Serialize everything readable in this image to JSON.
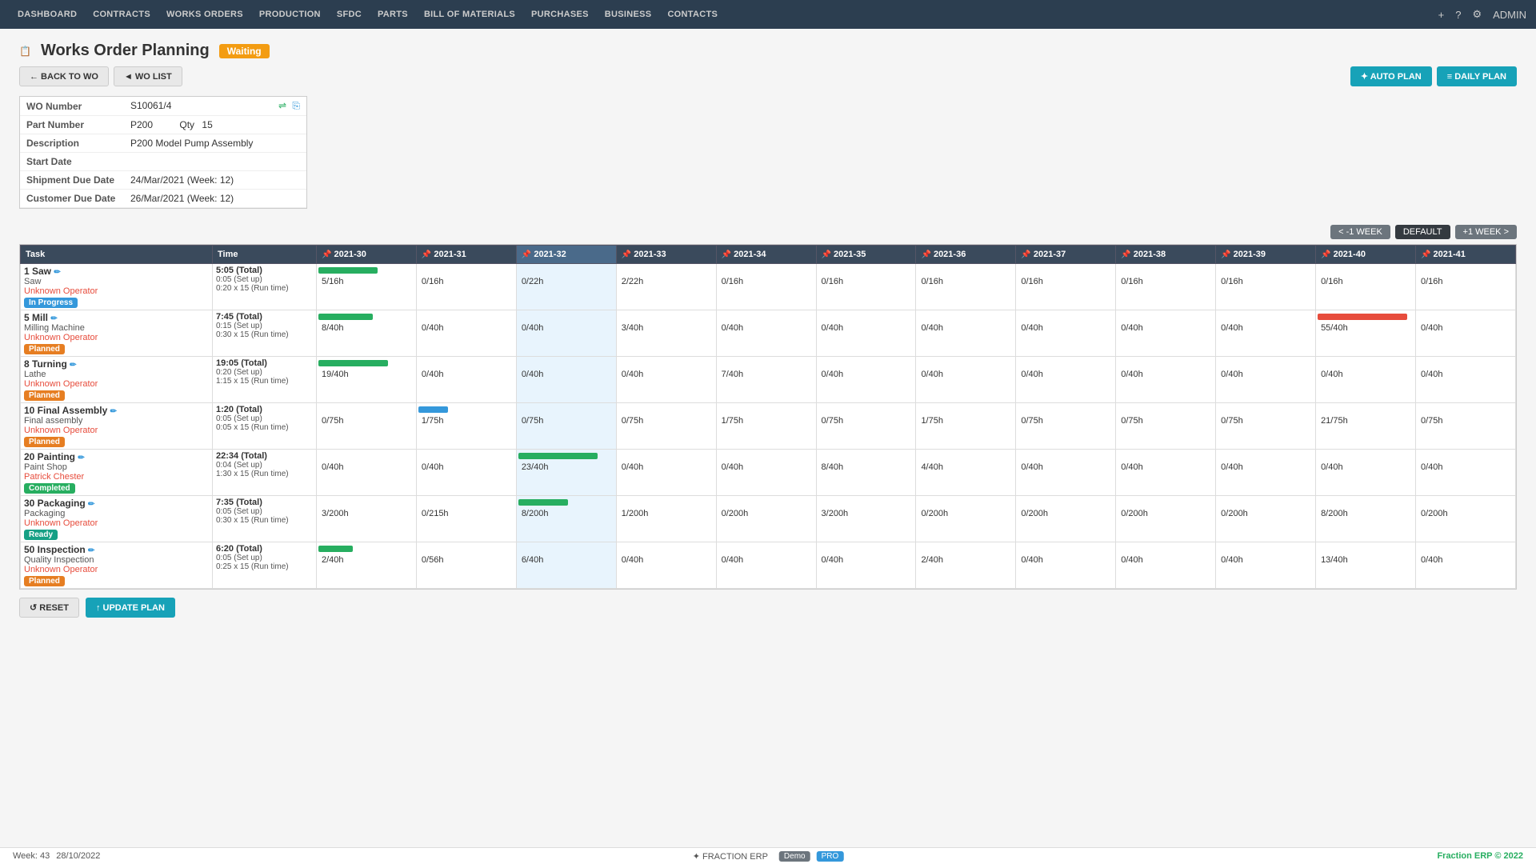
{
  "nav": {
    "items": [
      "DASHBOARD",
      "CONTRACTS",
      "WORKS ORDERS",
      "PRODUCTION",
      "SFDC",
      "PARTS",
      "BILL OF MATERIALS",
      "PURCHASES",
      "BUSINESS",
      "CONTACTS"
    ],
    "admin": "ADMIN"
  },
  "page": {
    "title": "Works Order Planning",
    "status": "Waiting",
    "back_btn": "← BACK TO WO",
    "list_btn": "◄ WO LIST",
    "auto_plan": "✦ AUTO PLAN",
    "daily_plan": "≡ DAILY PLAN"
  },
  "wo": {
    "number_label": "WO Number",
    "number_value": "S10061/4",
    "part_label": "Part Number",
    "part_value": "P200",
    "qty_label": "Qty",
    "qty_value": "15",
    "desc_label": "Description",
    "desc_value": "P200 Model Pump Assembly",
    "start_label": "Start Date",
    "start_value": "",
    "ship_label": "Shipment Due Date",
    "ship_value": "24/Mar/2021 (Week: 12)",
    "cust_label": "Customer Due Date",
    "cust_value": "26/Mar/2021 (Week: 12)"
  },
  "week_nav": {
    "prev": "< -1 WEEK",
    "default": "DEFAULT",
    "next": "+1 WEEK >"
  },
  "columns": {
    "task": "Task",
    "time": "Time",
    "weeks": [
      "2021-30",
      "2021-31",
      "2021-32",
      "2021-33",
      "2021-34",
      "2021-35",
      "2021-36",
      "2021-37",
      "2021-38",
      "2021-39",
      "2021-40",
      "2021-41"
    ]
  },
  "tasks": [
    {
      "id": "1 Saw",
      "sub": "Saw",
      "operator": "Unknown Operator",
      "status": "In Progress",
      "status_key": "inprogress",
      "total": "5:05 (Total)",
      "setup": "0:05 (Set up)",
      "runtime": "0:20 x 15 (Run time)",
      "weeks": [
        "5/16h",
        "0/16h",
        "0/22h",
        "2/22h",
        "0/16h",
        "0/16h",
        "0/16h",
        "0/16h",
        "0/16h",
        "0/16h",
        "0/16h",
        "0/16h"
      ],
      "bar_week": 0,
      "bar_pct": 60,
      "bar_color": "green",
      "highlight_week": 2
    },
    {
      "id": "5 Mill",
      "sub": "Milling Machine",
      "operator": "Unknown Operator",
      "status": "Planned",
      "status_key": "planned",
      "total": "7:45 (Total)",
      "setup": "0:15 (Set up)",
      "runtime": "0:30 x 15 (Run time)",
      "weeks": [
        "8/40h",
        "0/40h",
        "0/40h",
        "3/40h",
        "0/40h",
        "0/40h",
        "0/40h",
        "0/40h",
        "0/40h",
        "0/40h",
        "55/40h",
        "0/40h"
      ],
      "bar_week": 0,
      "bar_pct": 55,
      "bar_color": "green",
      "bar2_week": 10,
      "bar2_pct": 90,
      "bar2_color": "red",
      "highlight_week": 2
    },
    {
      "id": "8 Turning",
      "sub": "Lathe",
      "operator": "Unknown Operator",
      "status": "Planned",
      "status_key": "planned",
      "total": "19:05 (Total)",
      "setup": "0:20 (Set up)",
      "runtime": "1:15 x 15 (Run time)",
      "weeks": [
        "19/40h",
        "0/40h",
        "0/40h",
        "0/40h",
        "7/40h",
        "0/40h",
        "0/40h",
        "0/40h",
        "0/40h",
        "0/40h",
        "0/40h",
        "0/40h"
      ],
      "bar_week": 0,
      "bar_pct": 70,
      "bar_color": "green",
      "highlight_week": 2
    },
    {
      "id": "10 Final Assembly",
      "sub": "Final assembly",
      "operator": "Unknown Operator",
      "status": "Planned",
      "status_key": "planned",
      "total": "1:20 (Total)",
      "setup": "0:05 (Set up)",
      "runtime": "0:05 x 15 (Run time)",
      "weeks": [
        "0/75h",
        "1/75h",
        "0/75h",
        "0/75h",
        "1/75h",
        "0/75h",
        "1/75h",
        "0/75h",
        "0/75h",
        "0/75h",
        "21/75h",
        "0/75h"
      ],
      "bar_week": 1,
      "bar_pct": 30,
      "bar_color": "blue",
      "highlight_week": 2
    },
    {
      "id": "20 Painting",
      "sub": "Paint Shop",
      "operator": "Patrick Chester",
      "status": "Completed",
      "status_key": "completed",
      "total": "22:34 (Total)",
      "setup": "0:04 (Set up)",
      "runtime": "1:30 x 15 (Run time)",
      "weeks": [
        "0/40h",
        "0/40h",
        "23/40h",
        "0/40h",
        "0/40h",
        "8/40h",
        "4/40h",
        "0/40h",
        "0/40h",
        "0/40h",
        "0/40h",
        "0/40h"
      ],
      "bar_week": 2,
      "bar_pct": 80,
      "bar_color": "green",
      "highlight_week": 2
    },
    {
      "id": "30 Packaging",
      "sub": "Packaging",
      "operator": "Unknown Operator",
      "status": "Ready",
      "status_key": "ready",
      "total": "7:35 (Total)",
      "setup": "0:05 (Set up)",
      "runtime": "0:30 x 15 (Run time)",
      "weeks": [
        "3/200h",
        "0/215h",
        "8/200h",
        "1/200h",
        "0/200h",
        "3/200h",
        "0/200h",
        "0/200h",
        "0/200h",
        "0/200h",
        "8/200h",
        "0/200h"
      ],
      "bar_week": 2,
      "bar_pct": 50,
      "bar_color": "green",
      "highlight_week": 2
    },
    {
      "id": "50 Inspection",
      "sub": "Quality Inspection",
      "operator": "Unknown Operator",
      "status": "Planned",
      "status_key": "planned",
      "total": "6:20 (Total)",
      "setup": "0:05 (Set up)",
      "runtime": "0:25 x 15 (Run time)",
      "weeks": [
        "2/40h",
        "0/56h",
        "6/40h",
        "0/40h",
        "0/40h",
        "0/40h",
        "2/40h",
        "0/40h",
        "0/40h",
        "0/40h",
        "13/40h",
        "0/40h"
      ],
      "bar_week": 0,
      "bar_pct": 35,
      "bar_color": "green",
      "highlight_week": 2
    }
  ],
  "footer": {
    "week_label": "Week: 43",
    "date_label": "28/10/2022",
    "logo": "✦ FRACTION ERP",
    "demo": "Demo",
    "pro": "PRO",
    "copy": "Fraction ERP © 2022"
  },
  "bottom_buttons": {
    "reset": "↺ RESET",
    "update": "↑ UPDATE PLAN"
  }
}
